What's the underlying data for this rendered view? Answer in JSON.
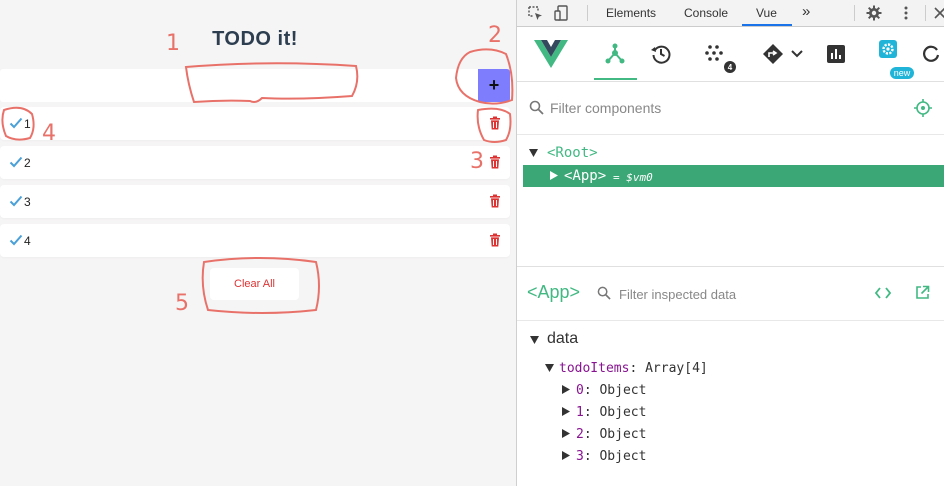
{
  "app": {
    "title": "TODO it!",
    "input": {
      "value": "",
      "placeholder": ""
    },
    "add_label": "+",
    "todos": [
      {
        "text": "1"
      },
      {
        "text": "2"
      },
      {
        "text": "3"
      },
      {
        "text": "4"
      }
    ],
    "clear_label": "Clear All",
    "annotations": [
      "1",
      "2",
      "3",
      "4",
      "5"
    ]
  },
  "devtools": {
    "tabs": [
      "Elements",
      "Console",
      "Vue"
    ],
    "active_tab": "Vue",
    "more_tabs": "»",
    "toolbar": {
      "events_badge": "4",
      "settings_badge": "new"
    },
    "components": {
      "filter_placeholder": "Filter components",
      "root": "<Root>",
      "app": "<App>",
      "app_ref": "= $vm0"
    },
    "inspector": {
      "title": "<App>",
      "filter_placeholder": "Filter inspected data",
      "section": "data",
      "prop_key": "todoItems",
      "prop_value": "Array[4]",
      "items": [
        {
          "key": "0",
          "value": "Object"
        },
        {
          "key": "1",
          "value": "Object"
        },
        {
          "key": "2",
          "value": "Object"
        },
        {
          "key": "3",
          "value": "Object"
        }
      ]
    },
    "colors": {
      "vue_green": "#42b983",
      "selected_row": "#3ba776",
      "add_button": "#7d7dfe",
      "delete_red": "#d33"
    }
  }
}
